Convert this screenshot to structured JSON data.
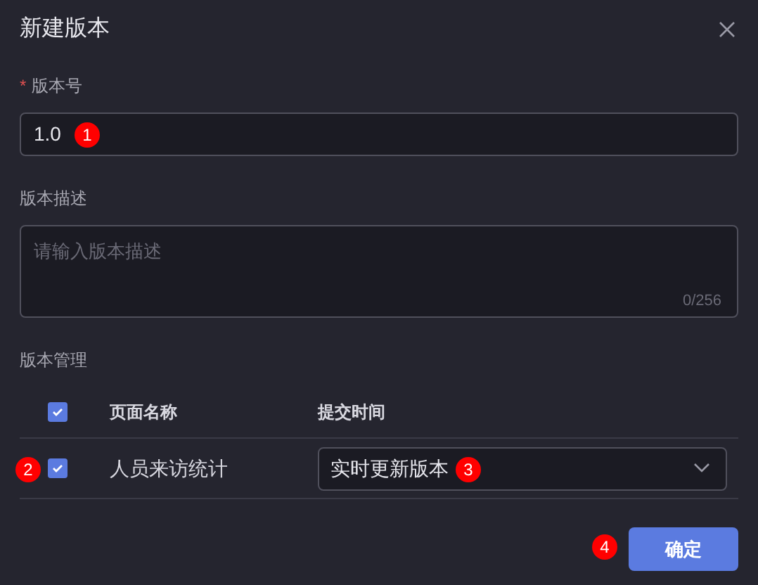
{
  "dialog": {
    "title": "新建版本"
  },
  "version_field": {
    "label": "版本号",
    "required_mark": "*",
    "value": "1.0",
    "callout": "1"
  },
  "description_field": {
    "label": "版本描述",
    "placeholder": "请输入版本描述",
    "counter": "0/256"
  },
  "management": {
    "label": "版本管理",
    "header": {
      "checked": true,
      "columns": [
        "页面名称",
        "提交时间"
      ]
    },
    "rows": [
      {
        "checked": true,
        "name": "人员来访统计",
        "time": "实时更新版本",
        "row_callout": "2",
        "select_callout": "3"
      }
    ]
  },
  "confirm": {
    "label": "确定",
    "callout": "4"
  }
}
